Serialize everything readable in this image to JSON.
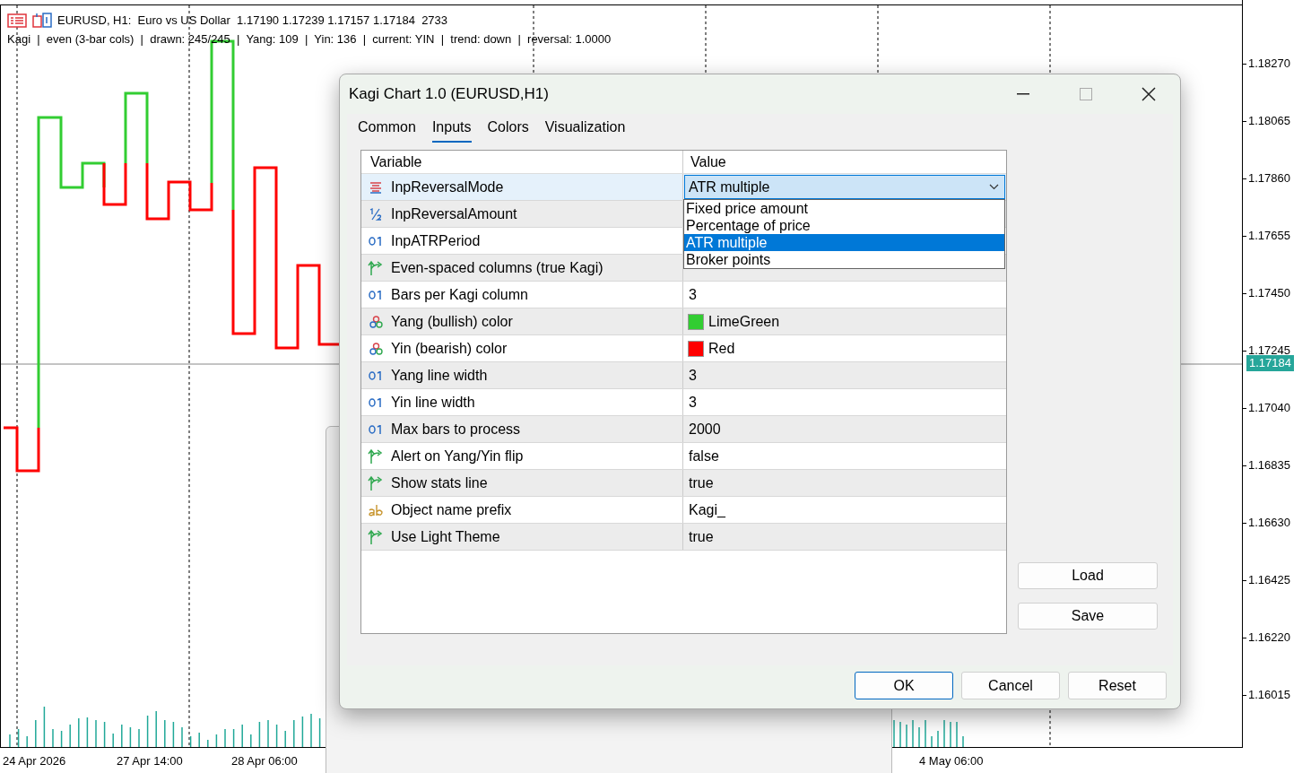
{
  "chart": {
    "symbol_line": "EURUSD, H1:  Euro vs US Dollar  1.17190 1.17239 1.17157 1.17184  2733",
    "stats_line": "Kagi  |  even (3-bar cols)  |  drawn: 245/245  |  Yang: 109  |  Yin: 136  |  current: YIN  |  trend: down  |  reversal: 1.0000",
    "price_labels": [
      "1.18270",
      "1.18065",
      "1.17860",
      "1.17655",
      "1.17450",
      "1.17245",
      "1.17040",
      "1.16835",
      "1.16630",
      "1.16425",
      "1.16220",
      "1.16015"
    ],
    "current_price": "1.17184",
    "time_labels": [
      "24 Apr 2026",
      "27 Apr 14:00",
      "28 Apr 06:00",
      "4 May 06:00"
    ]
  },
  "dialog": {
    "title": "Kagi Chart 1.0 (EURUSD,H1)",
    "tabs": [
      {
        "label": "Common",
        "selected": false
      },
      {
        "label": "Inputs",
        "selected": true
      },
      {
        "label": "Colors",
        "selected": false
      },
      {
        "label": "Visualization",
        "selected": false
      }
    ],
    "table": {
      "columns": [
        "Variable",
        "Value"
      ],
      "rows": [
        {
          "kind": "enum",
          "name": "InpReversalMode",
          "value": "ATR multiple",
          "selected": true
        },
        {
          "kind": "double",
          "name": "InpReversalAmount",
          "selected": false
        },
        {
          "kind": "int",
          "name": "InpATRPeriod",
          "selected": false
        },
        {
          "kind": "bool",
          "name": "Even-spaced columns (true Kagi)",
          "selected": false
        },
        {
          "kind": "int",
          "name": "Bars per Kagi column",
          "value": "3",
          "selected": false
        },
        {
          "kind": "color",
          "name": "Yang (bullish) color",
          "value": "LimeGreen",
          "color": "#32cd32",
          "selected": false
        },
        {
          "kind": "color",
          "name": "Yin (bearish) color",
          "value": "Red",
          "color": "#ff0000",
          "selected": false
        },
        {
          "kind": "int",
          "name": "Yang line width",
          "value": "3",
          "selected": false
        },
        {
          "kind": "int",
          "name": "Yin line width",
          "value": "3",
          "selected": false
        },
        {
          "kind": "int",
          "name": "Max bars to process",
          "value": "2000",
          "selected": false
        },
        {
          "kind": "bool",
          "name": "Alert on Yang/Yin flip",
          "value": "false",
          "selected": false
        },
        {
          "kind": "bool",
          "name": "Show stats line",
          "value": "true",
          "selected": false
        },
        {
          "kind": "string",
          "name": "Object name prefix",
          "value": "Kagi_",
          "selected": false
        },
        {
          "kind": "bool",
          "name": "Use Light Theme",
          "value": "true",
          "selected": false
        }
      ]
    },
    "dropdown_options": [
      {
        "label": "Fixed price amount",
        "selected": false
      },
      {
        "label": "Percentage of price",
        "selected": false
      },
      {
        "label": "ATR multiple",
        "selected": true
      },
      {
        "label": "Broker points",
        "selected": false
      }
    ],
    "side_buttons": [
      "Load",
      "Save"
    ],
    "buttons": [
      {
        "label": "OK",
        "default": true
      },
      {
        "label": "Cancel",
        "default": false
      },
      {
        "label": "Reset",
        "default": false
      }
    ]
  }
}
